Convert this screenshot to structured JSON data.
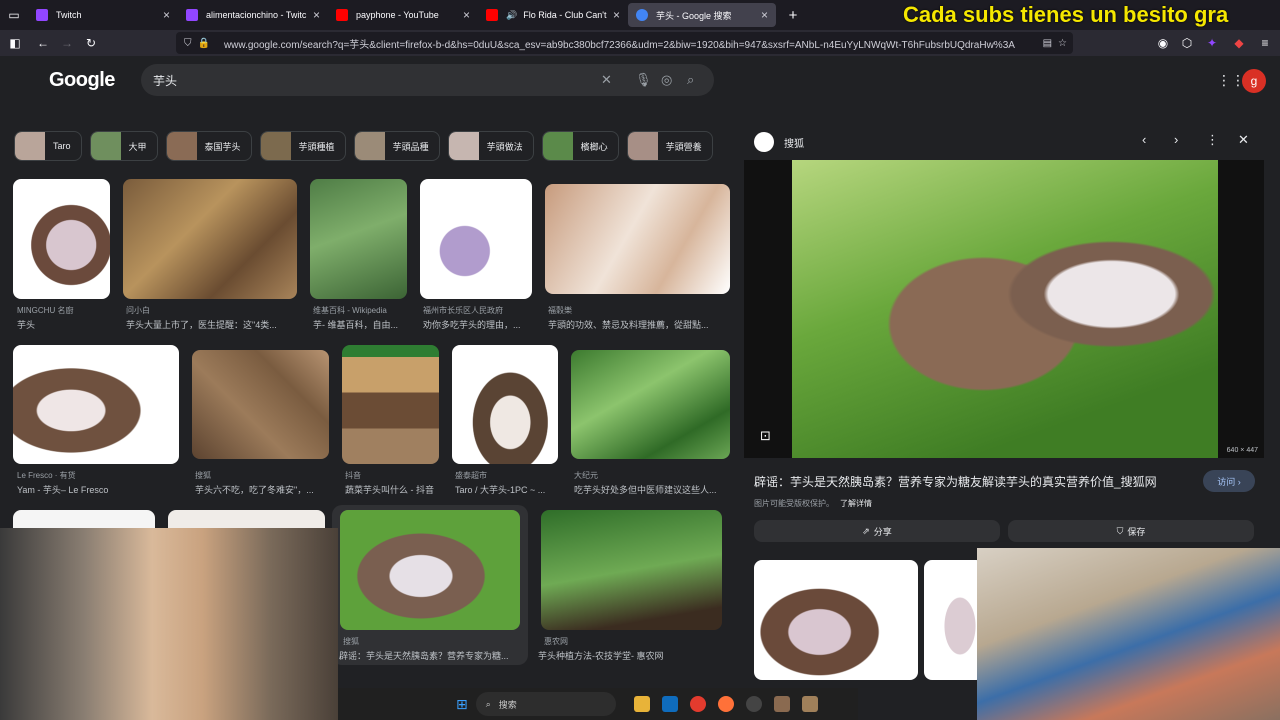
{
  "browser": {
    "tabs": [
      {
        "label": "Twitch",
        "color": "#9146ff"
      },
      {
        "label": "alimentacionchino - Twitch",
        "color": "#9146ff"
      },
      {
        "label": "payphone - YouTube",
        "color": "#ff0000"
      },
      {
        "label": "Flo Rida - Club Can't Han",
        "color": "#ff0000"
      },
      {
        "label": "芋头 - Google 搜索",
        "color": "#4285f4"
      }
    ],
    "new_tab": "+",
    "url": "www.google.com/search?q=芋头&client=firefox-b-d&hs=0duU&sca_esv=ab9bc380bcf72366&udm=2&biw=1920&bih=947&sxsrf=ANbL-n4EuYyLNWqWt-T6hFubsrbUQdraHw%3A",
    "overlay": "Cada subs tienes un besito gra"
  },
  "google": {
    "logo": "Google",
    "query": "芋头"
  },
  "chips": [
    {
      "label": "Taro",
      "color": "#b9a59a"
    },
    {
      "label": "大甲",
      "color": "#6f8f5e"
    },
    {
      "label": "泰国芋头",
      "color": "#8a6b55"
    },
    {
      "label": "芋頭種植",
      "color": "#7c6a4e"
    },
    {
      "label": "芋頭品種",
      "color": "#9b8b78"
    },
    {
      "label": "芋頭做法",
      "color": "#c6b6b0"
    },
    {
      "label": "檳榔心",
      "color": "#5b8a4a"
    },
    {
      "label": "芋頭營養",
      "color": "#a78f86"
    }
  ],
  "results": [
    {
      "source": "MINGCHU 名廚",
      "title": "芋头"
    },
    {
      "source": "问小白",
      "title": "芋头大量上市了，医生提醒：这\"4类..."
    },
    {
      "source": "维基百科 - Wikipedia",
      "title": "芋- 维基百科，自由..."
    },
    {
      "source": "福州市长乐区人民政府",
      "title": "劝你多吃芋头的理由，..."
    },
    {
      "source": "福穀樂",
      "title": "芋頭的功效、禁忌及料理推薦，從甜點..."
    },
    {
      "source": "Le Fresco · 有货",
      "title": "Yam - 芋头– Le Fresco"
    },
    {
      "source": "搜狐",
      "title": "芋头六不吃，吃了冬难安\"，..."
    },
    {
      "source": "抖音",
      "title": "蔬菜芋头叫什么 - 抖音"
    },
    {
      "source": "盛泰超市",
      "title": "Taro / 大芋头-1PC ~ ..."
    },
    {
      "source": "大纪元",
      "title": "吃芋头好处多但中医师建议这些人..."
    },
    {
      "source": "搜狐",
      "title": "辟谣：芋头是天然胰岛素？营养专家为糖..."
    },
    {
      "source": "惠农网",
      "title": "芋头种植方法-农技学堂- 惠农网"
    }
  ],
  "panel": {
    "source": "搜狐",
    "size": "640 × 447",
    "title": "辟谣：芋头是天然胰岛素？营养专家为糖友解读芋头的真实营养价值_搜狐网",
    "visit": "访问 ›",
    "note": "图片可能受版权保护。",
    "learn_more": "了解详情",
    "share": "分享",
    "save": "保存"
  },
  "taskbar": {
    "search": "搜索"
  }
}
